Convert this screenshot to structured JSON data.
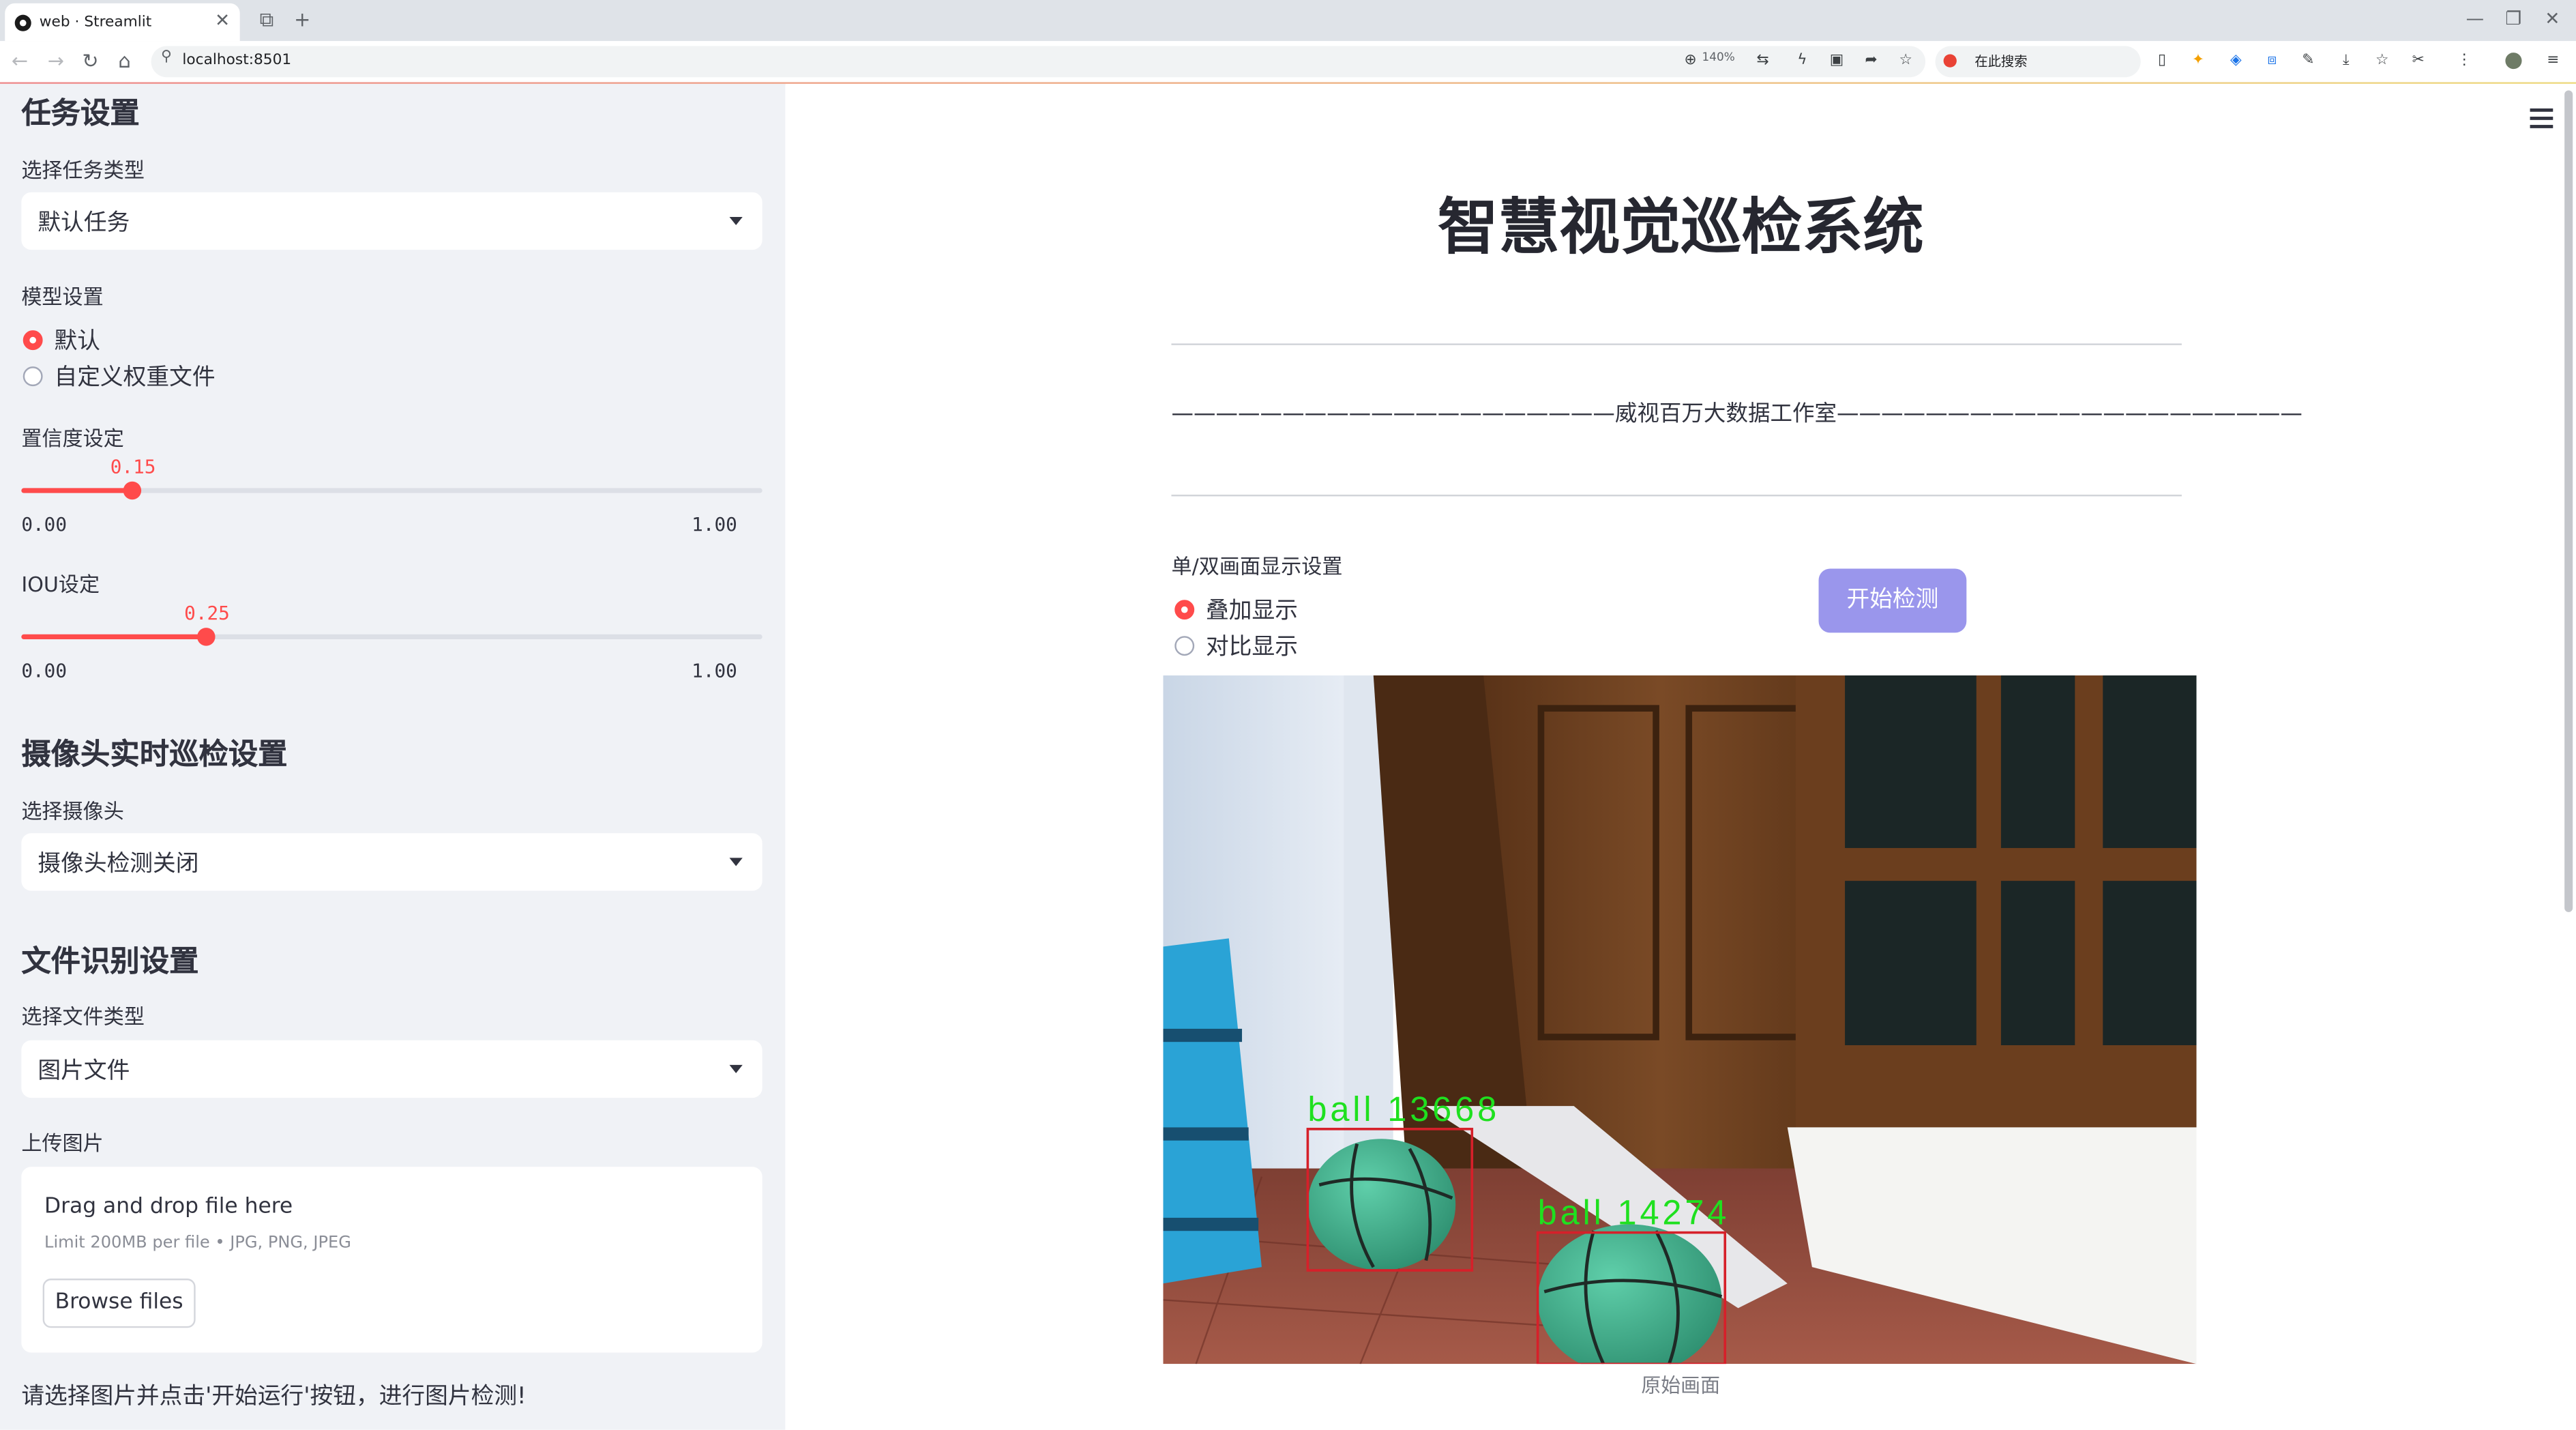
{
  "browser": {
    "tab_title": "web · Streamlit",
    "url": "localhost:8501",
    "zoom": "140%",
    "search_placeholder": "在此搜索"
  },
  "sidebar": {
    "task_section_title": "任务设置",
    "task_type_label": "选择任务类型",
    "task_type_value": "默认任务",
    "model_label": "模型设置",
    "model_options": [
      "默认",
      "自定义权重文件"
    ],
    "model_selected": "默认",
    "conf_label": "置信度设定",
    "conf_value": "0.15",
    "conf_min": "0.00",
    "conf_max": "1.00",
    "iou_label": "IOU设定",
    "iou_value": "0.25",
    "iou_min": "0.00",
    "iou_max": "1.00",
    "camera_section_title": "摄像头实时巡检设置",
    "camera_label": "选择摄像头",
    "camera_value": "摄像头检测关闭",
    "file_section_title": "文件识别设置",
    "file_type_label": "选择文件类型",
    "file_type_value": "图片文件",
    "upload_label": "上传图片",
    "upload_drag_text": "Drag and drop file here",
    "upload_limit_text": "Limit 200MB per file • JPG, PNG, JPEG",
    "browse_button": "Browse files",
    "hint": "请选择图片并点击'开始运行'按钮，进行图片检测!"
  },
  "main": {
    "title": "智慧视觉巡检系统",
    "studio_line": "————————————————————威视百万大数据工作室—————————————————————",
    "display_label": "单/双画面显示设置",
    "display_options": [
      "叠加显示",
      "对比显示"
    ],
    "display_selected": "叠加显示",
    "start_button": "开始检测",
    "image_caption": "原始画面",
    "detections": [
      {
        "label": "ball",
        "id": "13668"
      },
      {
        "label": "ball",
        "id": "14274"
      }
    ]
  },
  "colors": {
    "accent": "#ff4b4b",
    "start_button": "#9a96ec",
    "sidebar_bg": "#f0f2f6",
    "detection_box": "#d6202a",
    "detection_text": "#1fe01f"
  }
}
